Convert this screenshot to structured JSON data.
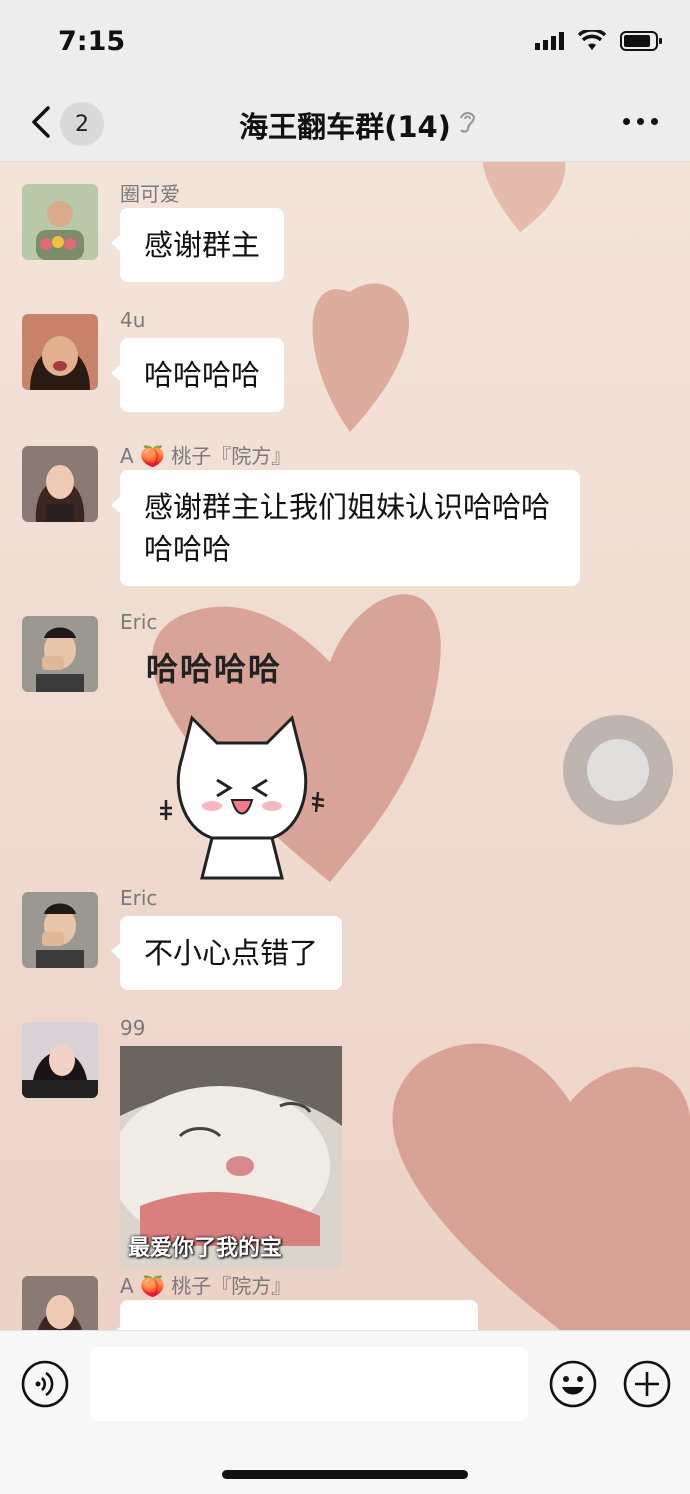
{
  "status": {
    "time": "7:15"
  },
  "nav": {
    "back_count": "2",
    "title": "海王翻车群(14)"
  },
  "messages": [
    {
      "sender": "圈可爱",
      "text": "感谢群主"
    },
    {
      "sender": "4u",
      "text": "哈哈哈哈"
    },
    {
      "sender": "A 🍑 桃子『院方』",
      "text": "感谢群主让我们姐妹认识哈哈哈哈哈哈"
    },
    {
      "sender": "Eric",
      "sticker_text": "哈哈哈哈"
    },
    {
      "sender": "Eric",
      "text": "不小心点错了"
    },
    {
      "sender": "99",
      "sticker_caption": "最爱你了我的宝"
    },
    {
      "sender": "A 🍑 桃子『院方』",
      "text": ""
    }
  ],
  "icons": [
    "back-icon",
    "ear-icon",
    "more-icon",
    "voice-icon",
    "emoji-icon",
    "plus-icon"
  ]
}
